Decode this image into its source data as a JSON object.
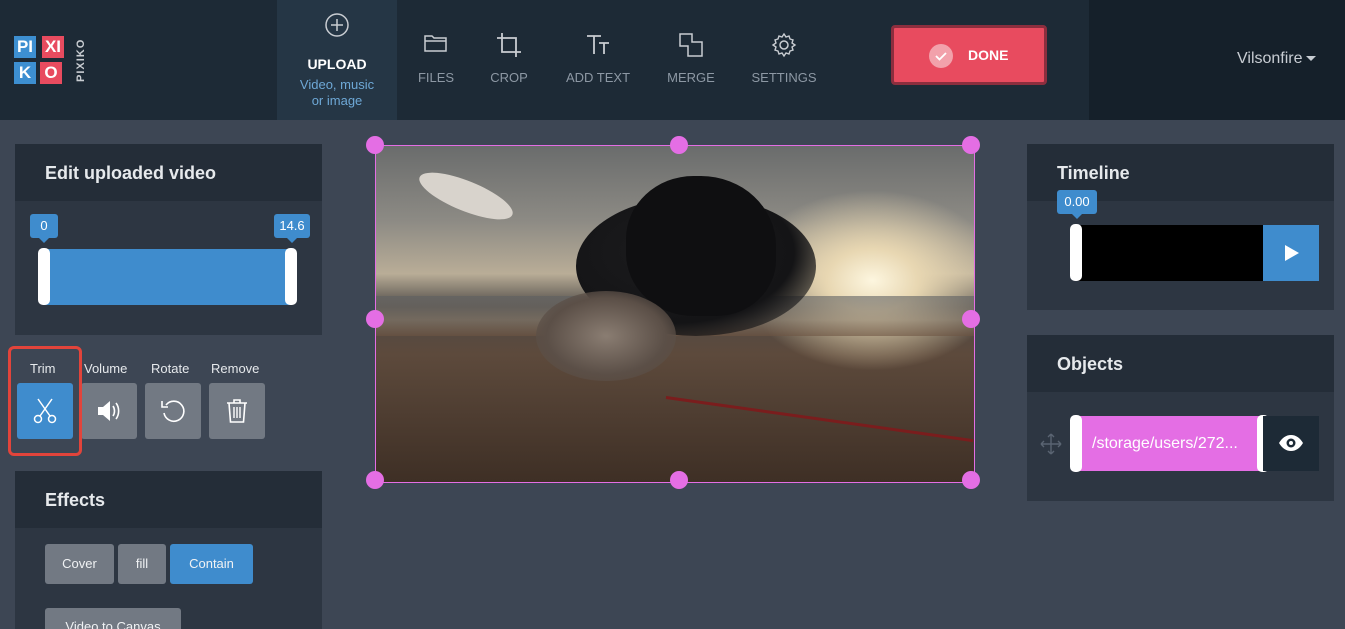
{
  "logo": {
    "tiles": [
      "PI",
      "XI",
      "K",
      "O"
    ],
    "vertical_text": "PIXIKO"
  },
  "nav": {
    "upload": {
      "label": "UPLOAD",
      "sub1": "Video, music",
      "sub2": "or image",
      "icon": "plus-circle-icon"
    },
    "files": {
      "label": "FILES",
      "icon": "folder-icon"
    },
    "crop": {
      "label": "CROP",
      "icon": "crop-icon"
    },
    "add_text": {
      "label": "ADD TEXT",
      "icon": "text-icon"
    },
    "merge": {
      "label": "MERGE",
      "icon": "merge-icon"
    },
    "settings": {
      "label": "SETTINGS",
      "icon": "gear-icon"
    }
  },
  "done_button": {
    "label": "DONE",
    "color": "#e84b5f"
  },
  "user": {
    "name": "Vilsonfire"
  },
  "edit_panel": {
    "title": "Edit uploaded video",
    "range": {
      "start_label": "0",
      "end_label": "14.6"
    },
    "tools": [
      {
        "label": "Trim",
        "icon": "scissors-icon",
        "active": true
      },
      {
        "label": "Volume",
        "icon": "volume-icon",
        "active": false
      },
      {
        "label": "Rotate",
        "icon": "rotate-icon",
        "active": false
      },
      {
        "label": "Remove",
        "icon": "trash-icon",
        "active": false
      }
    ]
  },
  "effects_panel": {
    "title": "Effects",
    "buttons": [
      {
        "label": "Cover",
        "active": false
      },
      {
        "label": "fill",
        "active": false
      },
      {
        "label": "Contain",
        "active": true
      },
      {
        "label": "Video to Canvas",
        "active": false
      }
    ]
  },
  "timeline_panel": {
    "title": "Timeline",
    "time_label": "0.00"
  },
  "objects_panel": {
    "title": "Objects",
    "object_path": "/storage/users/272..."
  },
  "colors": {
    "accent": "#3f8ccd",
    "object": "#e46ee4",
    "done": "#e84b5f",
    "highlight": "#e2443b"
  }
}
